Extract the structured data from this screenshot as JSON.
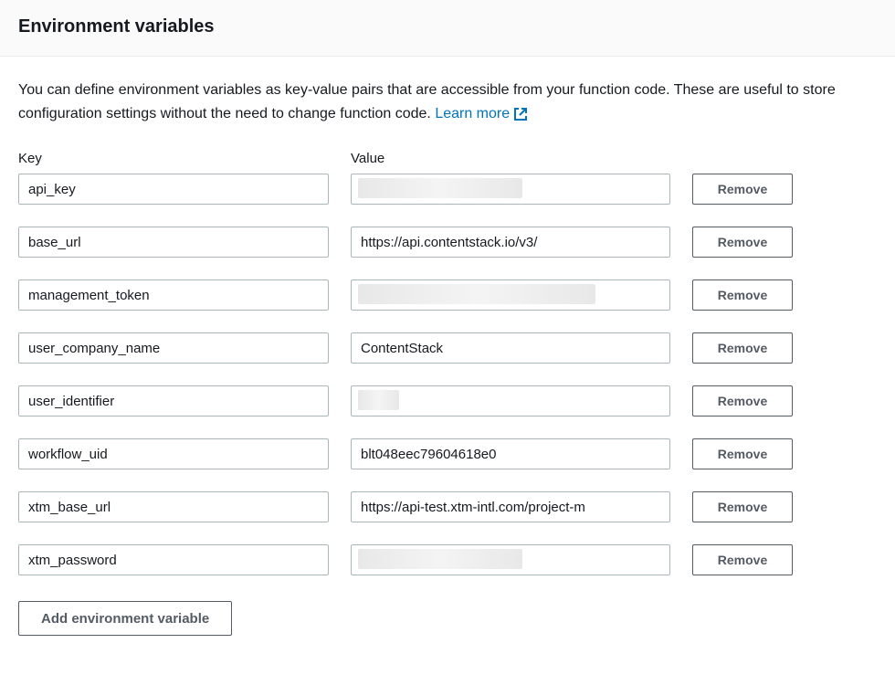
{
  "header": {
    "title": "Environment variables"
  },
  "description": {
    "text": "You can define environment variables as key-value pairs that are accessible from your function code. These are useful to store configuration settings without the need to change function code. ",
    "learn_more_label": "Learn more"
  },
  "columns": {
    "key_label": "Key",
    "value_label": "Value"
  },
  "rows": [
    {
      "key": "api_key",
      "value": "",
      "redacted": true,
      "redacted_width": 180
    },
    {
      "key": "base_url",
      "value": "https://api.contentstack.io/v3/",
      "redacted": false
    },
    {
      "key": "management_token",
      "value": "",
      "redacted": true,
      "redacted_width": 260
    },
    {
      "key": "user_company_name",
      "value": "ContentStack",
      "redacted": false
    },
    {
      "key": "user_identifier",
      "value": "",
      "redacted": true,
      "redacted_width": 45
    },
    {
      "key": "workflow_uid",
      "value": "blt048eec79604618e0",
      "redacted": false
    },
    {
      "key": "xtm_base_url",
      "value": "https://api-test.xtm-intl.com/project-m",
      "redacted": false
    },
    {
      "key": "xtm_password",
      "value": "",
      "redacted": true,
      "redacted_width": 180
    }
  ],
  "buttons": {
    "remove_label": "Remove",
    "add_label": "Add environment variable"
  }
}
